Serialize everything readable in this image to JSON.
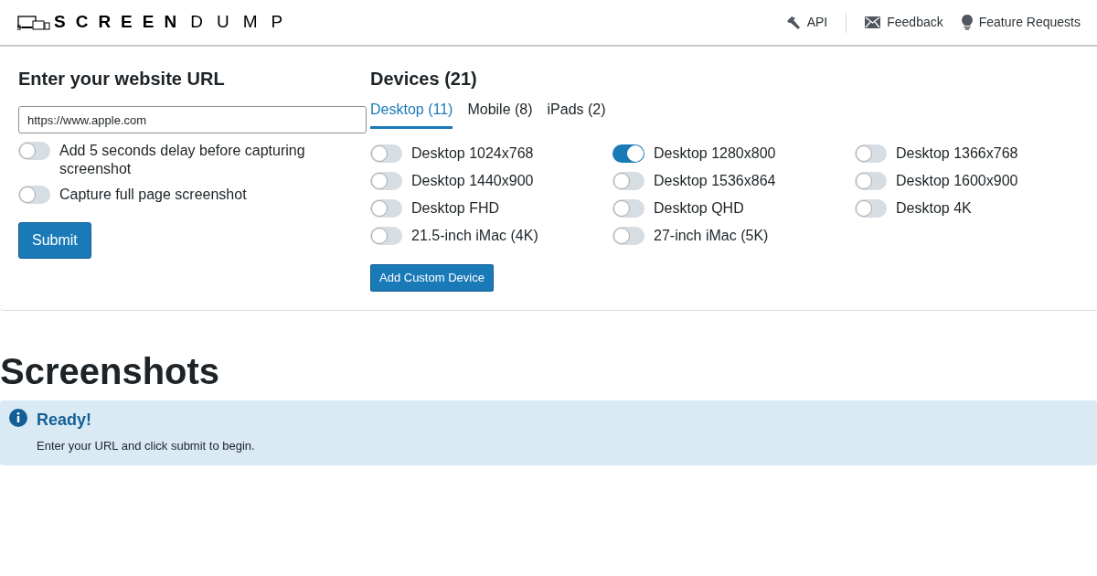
{
  "header": {
    "logo_bold": "SCREEN",
    "logo_light": "DUMP",
    "links": [
      {
        "kind": "api",
        "label": "API"
      },
      {
        "kind": "feedback",
        "label": "Feedback"
      },
      {
        "kind": "feature",
        "label": "Feature Requests"
      }
    ]
  },
  "url_form": {
    "title": "Enter your website URL",
    "url_value": "https://www.apple.com",
    "options": [
      {
        "label": "Add 5 seconds delay before capturing screenshot",
        "on": false
      },
      {
        "label": "Capture full page screenshot",
        "on": false
      }
    ],
    "submit": "Submit"
  },
  "devices": {
    "title": "Devices (21)",
    "tabs": [
      {
        "label": "Desktop (11)",
        "selected": true
      },
      {
        "label": "Mobile (8)",
        "selected": false
      },
      {
        "label": "iPads (2)",
        "selected": false
      }
    ],
    "items": [
      {
        "label": "Desktop 1024x768",
        "on": false
      },
      {
        "label": "Desktop 1280x800",
        "on": true
      },
      {
        "label": "Desktop 1366x768",
        "on": false
      },
      {
        "label": "Desktop 1440x900",
        "on": false
      },
      {
        "label": "Desktop 1536x864",
        "on": false
      },
      {
        "label": "Desktop 1600x900",
        "on": false
      },
      {
        "label": "Desktop FHD",
        "on": false
      },
      {
        "label": "Desktop QHD",
        "on": false
      },
      {
        "label": "Desktop 4K",
        "on": false
      },
      {
        "label": "21.5-inch iMac (4K)",
        "on": false
      },
      {
        "label": "27-inch iMac (5K)",
        "on": false
      }
    ],
    "add_button": "Add Custom Device"
  },
  "screenshots": {
    "title": "Screenshots",
    "alert": {
      "title": "Ready!",
      "message": "Enter your URL and click submit to begin."
    }
  }
}
